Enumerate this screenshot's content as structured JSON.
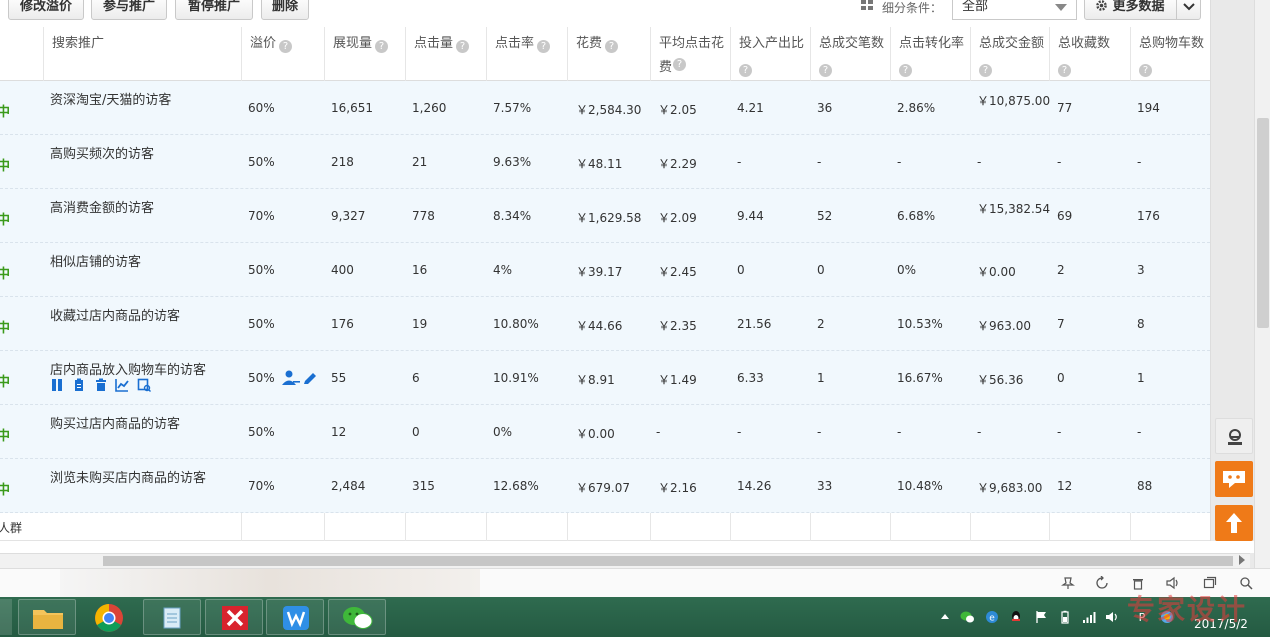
{
  "toolbar": {
    "buttons": [
      "修改溢价",
      "参与推广",
      "暂停推广",
      "删除"
    ],
    "filter_label": "细分条件：",
    "filter_value": "全部",
    "more_data": "更多数据"
  },
  "table": {
    "headers": {
      "name": "搜索推广",
      "premium": "溢价",
      "impressions": "展现量",
      "clicks": "点击量",
      "ctr": "点击率",
      "cost": "花费",
      "avg_cpc": "平均点击花费",
      "roi": "投入产出比",
      "orders": "总成交笔数",
      "conv_rate": "点击转化率",
      "gmv": "总成交金额",
      "favorites": "总收藏数",
      "carts": "总购物车数",
      "help": "?"
    },
    "status_char": "中",
    "rows": [
      {
        "name": "资深淘宝/天猫的访客",
        "premium": "60%",
        "impressions": "16,651",
        "clicks": "1,260",
        "ctr": "7.57%",
        "cost": "￥2,584.30",
        "avg_cpc": "￥2.05",
        "roi": "4.21",
        "orders": "36",
        "conv_rate": "2.86%",
        "gmv": "￥10,875.00",
        "favorites": "77",
        "carts": "194"
      },
      {
        "name": "高购买频次的访客",
        "premium": "50%",
        "impressions": "218",
        "clicks": "21",
        "ctr": "9.63%",
        "cost": "￥48.11",
        "avg_cpc": "￥2.29",
        "roi": "-",
        "orders": "-",
        "conv_rate": "-",
        "gmv": "-",
        "favorites": "-",
        "carts": "-"
      },
      {
        "name": "高消费金额的访客",
        "premium": "70%",
        "impressions": "9,327",
        "clicks": "778",
        "ctr": "8.34%",
        "cost": "￥1,629.58",
        "avg_cpc": "￥2.09",
        "roi": "9.44",
        "orders": "52",
        "conv_rate": "6.68%",
        "gmv": "￥15,382.54",
        "favorites": "69",
        "carts": "176"
      },
      {
        "name": "相似店铺的访客",
        "premium": "50%",
        "impressions": "400",
        "clicks": "16",
        "ctr": "4%",
        "cost": "￥39.17",
        "avg_cpc": "￥2.45",
        "roi": "0",
        "orders": "0",
        "conv_rate": "0%",
        "gmv": "￥0.00",
        "favorites": "2",
        "carts": "3"
      },
      {
        "name": "收藏过店内商品的访客",
        "premium": "50%",
        "impressions": "176",
        "clicks": "19",
        "ctr": "10.80%",
        "cost": "￥44.66",
        "avg_cpc": "￥2.35",
        "roi": "21.56",
        "orders": "2",
        "conv_rate": "10.53%",
        "gmv": "￥963.00",
        "favorites": "7",
        "carts": "8"
      },
      {
        "name": "店内商品放入购物车的访客",
        "premium": "50%",
        "impressions": "55",
        "clicks": "6",
        "ctr": "10.91%",
        "cost": "￥8.91",
        "avg_cpc": "￥1.49",
        "roi": "6.33",
        "orders": "1",
        "conv_rate": "16.67%",
        "gmv": "￥56.36",
        "favorites": "0",
        "carts": "1"
      },
      {
        "name": "购买过店内商品的访客",
        "premium": "50%",
        "impressions": "12",
        "clicks": "0",
        "ctr": "0%",
        "cost": "￥0.00",
        "avg_cpc": "-",
        "roi": "-",
        "orders": "-",
        "conv_rate": "-",
        "gmv": "-",
        "favorites": "-",
        "carts": "-"
      },
      {
        "name": "浏览未购买店内商品的访客",
        "premium": "70%",
        "impressions": "2,484",
        "clicks": "315",
        "ctr": "12.68%",
        "cost": "￥679.07",
        "avg_cpc": "￥2.16",
        "roi": "14.26",
        "orders": "33",
        "conv_rate": "10.48%",
        "gmv": "￥9,683.00",
        "favorites": "12",
        "carts": "88"
      }
    ],
    "group_label": "人群"
  },
  "taskbar": {
    "date": "2017/5/2"
  },
  "watermark": "专家设计",
  "colors": {
    "status_green": "#3a9a1a",
    "row_bg": "#f1f8fd",
    "accent_blue": "#1a6fd1",
    "float_orange": "#ef7a18",
    "taskbar": "#2a634a"
  }
}
